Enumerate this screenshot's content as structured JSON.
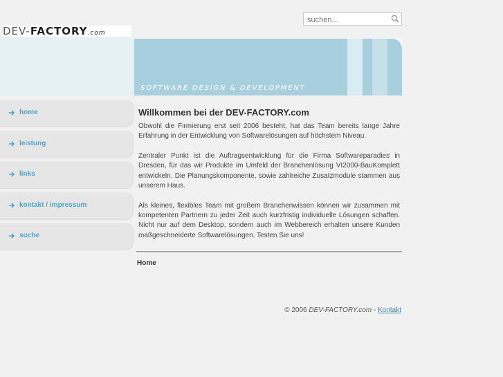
{
  "search": {
    "placeholder": "suchen..."
  },
  "logo": {
    "brand_thin": "DEV-",
    "brand_bold": "FACTORY",
    "suffix": ".com"
  },
  "banner": {
    "tagline": "Software Design & Development"
  },
  "nav": {
    "items": [
      {
        "label": "home"
      },
      {
        "label": "leistung"
      },
      {
        "label": "links"
      },
      {
        "label": "kontakt / impressum"
      },
      {
        "label": "suche"
      }
    ]
  },
  "main": {
    "title": "Willkommen bei der DEV-FACTORY.com",
    "paragraphs": [
      "Obwohl die Firmierung erst seit 2006 besteht, hat das Team bereits lange Jahre Erfahrung in der Entwicklung von Softwarelösungen auf höchstem Niveau.",
      "Zentraler Punkt ist die Auftragsentwicklung für die Firma Softwareparadies in Dresden, für das wir Produkte im Umfeld der Branchenlösung VI2000-BauKomplett entwickeln. Die Planungskomponente, sowie zahlreiche Zusatzmodule stammen aus unserem Haus.",
      "Als kleines, flexibles Team mit großem Branchenwissen können wir zusammen mit kompetenten Partnern zu jeder Zeit auch kurzfristig individuelle Lösungen schaffen. Nicht nur auf dem Desktop, sondern auch im Webbereich erhalten unsere Kunden maßgeschneiderte Softwarelösungen. Testen Sie uns!"
    ],
    "breadcrumb": "Home"
  },
  "footer": {
    "copyright": "© 2006",
    "brand": "DEV-FACTORY.com",
    "separator": "-",
    "contact_link": "Kontakt"
  },
  "colors": {
    "accent": "#4aa6c7",
    "banner": "#a8cfde",
    "banner_light": "#e5f1f5",
    "nav_bg": "#e6e6e6"
  }
}
